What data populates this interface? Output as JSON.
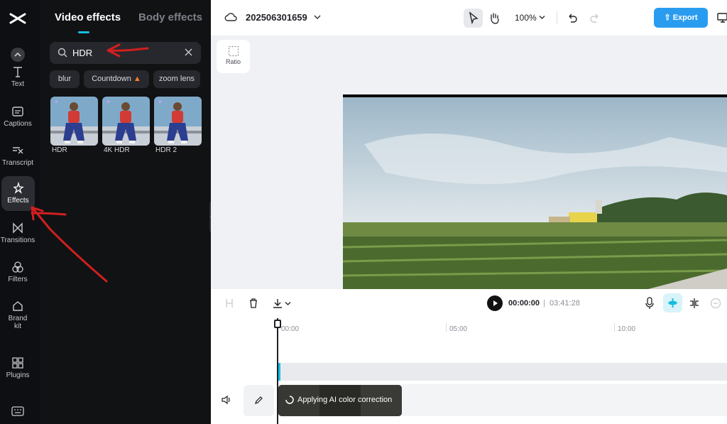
{
  "rail": {
    "items": [
      {
        "label": "Text",
        "icon": "text-icon"
      },
      {
        "label": "Captions",
        "icon": "captions-icon"
      },
      {
        "label": "Transcript",
        "icon": "transcript-icon"
      },
      {
        "label": "Effects",
        "icon": "effects-icon"
      },
      {
        "label": "Transitions",
        "icon": "transitions-icon"
      },
      {
        "label": "Filters",
        "icon": "filters-icon"
      },
      {
        "label": "Brand",
        "label2": "kit",
        "icon": "brand-kit-icon"
      },
      {
        "label": "Plugins",
        "icon": "plugins-icon"
      }
    ]
  },
  "panel": {
    "tabs": [
      "Video effects",
      "Body effects"
    ],
    "search": {
      "value": "HDR"
    },
    "chips": [
      "blur",
      "Countdown",
      "zoom lens"
    ],
    "results": [
      {
        "label": "HDR"
      },
      {
        "label": "4K HDR"
      },
      {
        "label": "HDR 2"
      }
    ]
  },
  "topbar": {
    "project_name": "202506301659",
    "zoom": "100%",
    "export_label": "Export"
  },
  "canvas": {
    "ratio_label": "Ratio"
  },
  "timeline": {
    "current_time": "00:00:00",
    "separator": "|",
    "total_time": "03:41:28",
    "ruler": [
      "00:00",
      "05:00",
      "10:00"
    ],
    "clip_status": "Applying AI color correction"
  },
  "colors": {
    "accent": "#16bde0",
    "export": "#2a9cf0",
    "annotation": "#d21f1f"
  }
}
